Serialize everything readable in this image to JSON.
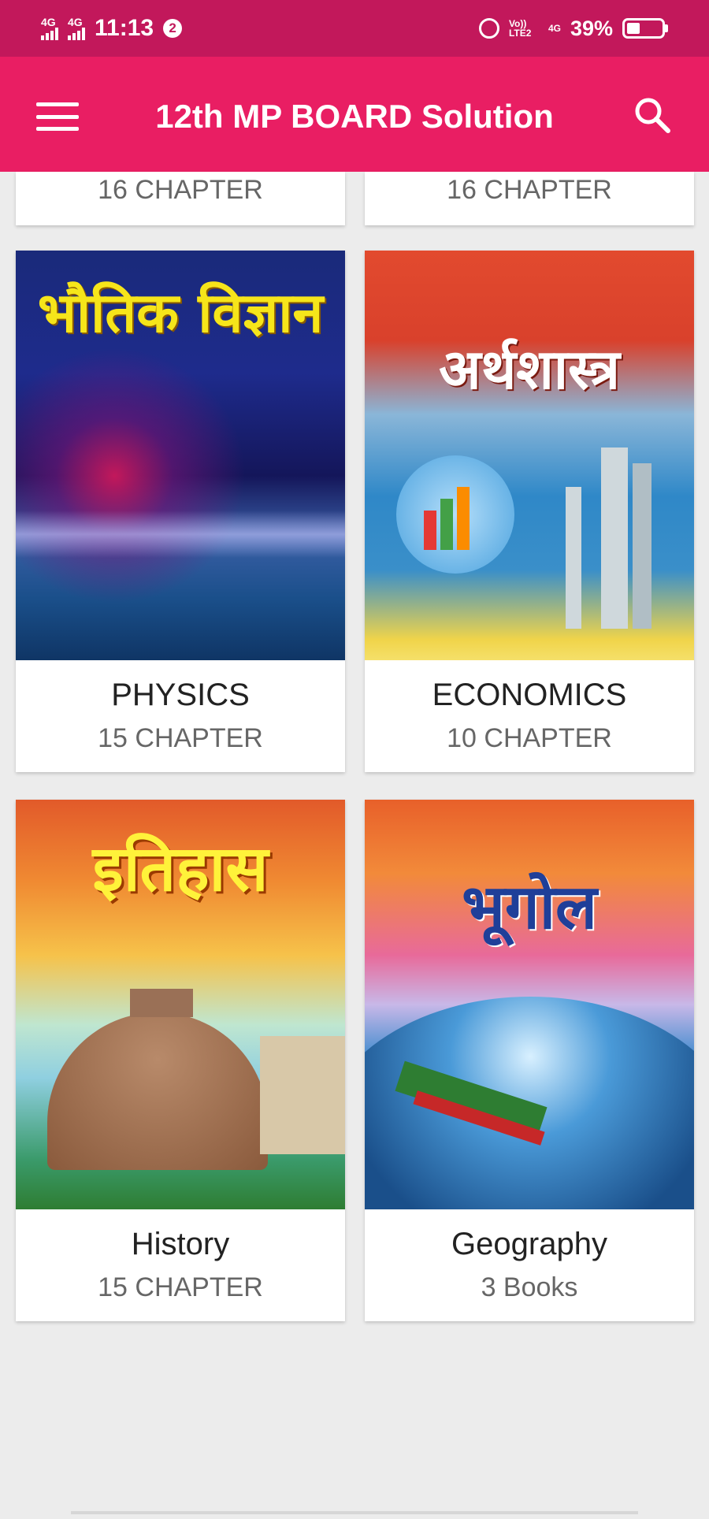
{
  "status": {
    "left_tag_1": "4G",
    "left_tag_2": "4G",
    "time": "11:13",
    "badge": "2",
    "volte_tag": "Vo)) LTE2",
    "net_tag": "4G",
    "battery": "39%",
    "battery_level": 0.39
  },
  "app_bar": {
    "title": "12th MP BOARD Solution",
    "menu_icon": "hamburger-menu-icon",
    "search_icon": "search-icon",
    "color": "#e91e63",
    "status_color": "#c2185b"
  },
  "cards": [
    {
      "name": "",
      "count": "16 CHAPTER"
    },
    {
      "name": "",
      "count": "16 CHAPTER"
    },
    {
      "name": "PHYSICS",
      "count": "15 CHAPTER",
      "cover_text": "भौतिक विज्ञान"
    },
    {
      "name": "ECONOMICS",
      "count": "10 CHAPTER",
      "cover_text": "अर्थशास्त्र"
    },
    {
      "name": "History",
      "count": "15 CHAPTER",
      "cover_text": "इतिहास"
    },
    {
      "name": "Geography",
      "count": "3 Books",
      "cover_text": "भूगोल"
    }
  ]
}
